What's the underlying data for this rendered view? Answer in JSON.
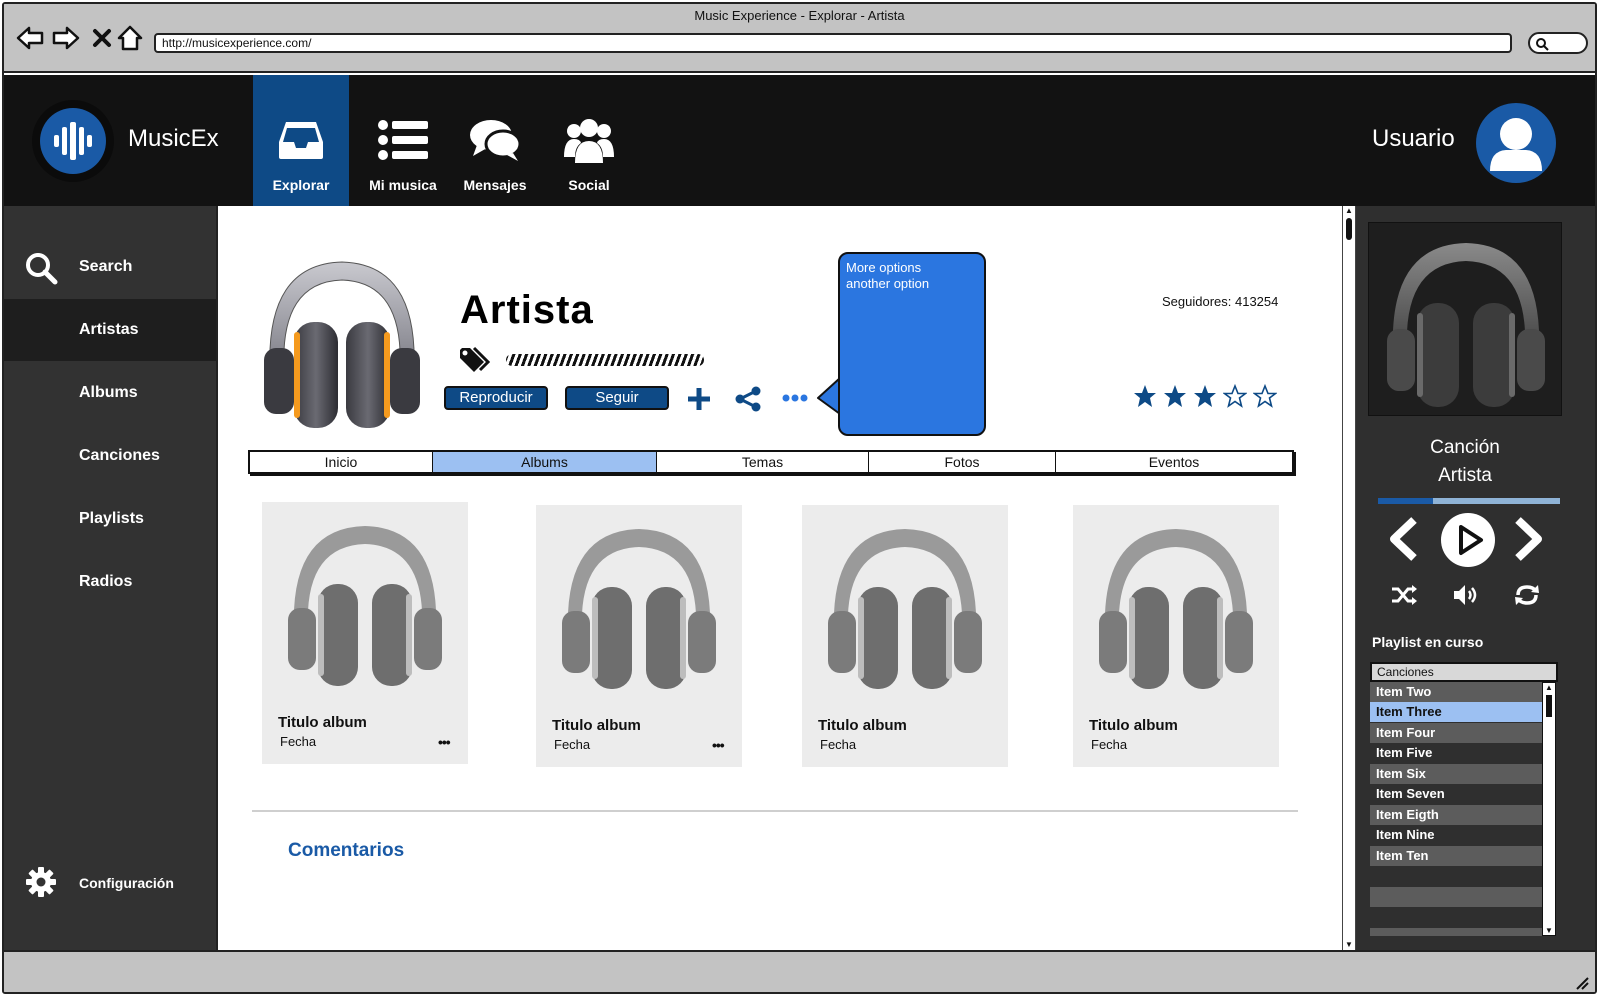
{
  "window": {
    "title": "Music Experience - Explorar - Artista",
    "url": "http://musicexperience.com/"
  },
  "brand": "MusicEx",
  "topnav": [
    {
      "label": "Explorar",
      "icon": "inbox-icon",
      "active": true
    },
    {
      "label": "Mi musica",
      "icon": "list-icon"
    },
    {
      "label": "Mensajes",
      "icon": "chat-icon"
    },
    {
      "label": "Social",
      "icon": "group-icon"
    }
  ],
  "user": {
    "name": "Usuario",
    "icon": "user-icon"
  },
  "sidebar": {
    "items": [
      {
        "label": "Search",
        "icon": "search-icon"
      },
      {
        "label": "Artistas",
        "active": true
      },
      {
        "label": "Albums"
      },
      {
        "label": "Canciones"
      },
      {
        "label": "Playlists"
      },
      {
        "label": "Radios"
      }
    ],
    "settings": {
      "label": "Configuración",
      "icon": "gear-icon"
    }
  },
  "artist": {
    "name": "Artista",
    "followers": "Seguidores: 413254",
    "rating": 3,
    "rating_max": 5,
    "buttons": {
      "play": "Reproducir",
      "follow": "Seguir"
    },
    "callout": {
      "line1": "More options",
      "line2": "another option"
    }
  },
  "tabs": [
    {
      "label": "Inicio"
    },
    {
      "label": "Albums",
      "active": true
    },
    {
      "label": "Temas"
    },
    {
      "label": "Fotos"
    },
    {
      "label": "Eventos"
    }
  ],
  "albums": [
    {
      "title": "Titulo album",
      "date": "Fecha",
      "more": "•••"
    },
    {
      "title": "Titulo album",
      "date": "Fecha",
      "more": "•••"
    },
    {
      "title": "Titulo album",
      "date": "Fecha"
    },
    {
      "title": "Titulo album",
      "date": "Fecha"
    }
  ],
  "comments_title": "Comentarios",
  "player": {
    "song": "Canción",
    "artist": "Artista",
    "progress": 0.3,
    "playlist_label": "Playlist en curso",
    "playlist_select": "Canciones",
    "playlist_items": [
      "Item Two",
      "Item Three",
      "Item Four",
      "Item Five",
      "Item Six",
      "Item Seven",
      "Item Eigth",
      "Item Nine",
      "Item Ten"
    ],
    "selected_index": 1
  },
  "colors": {
    "accent": "#0e4a86",
    "appbar": "#121212",
    "sidebar": "#323232",
    "selection": "#9cc0f2",
    "callout": "#2b76e0"
  }
}
